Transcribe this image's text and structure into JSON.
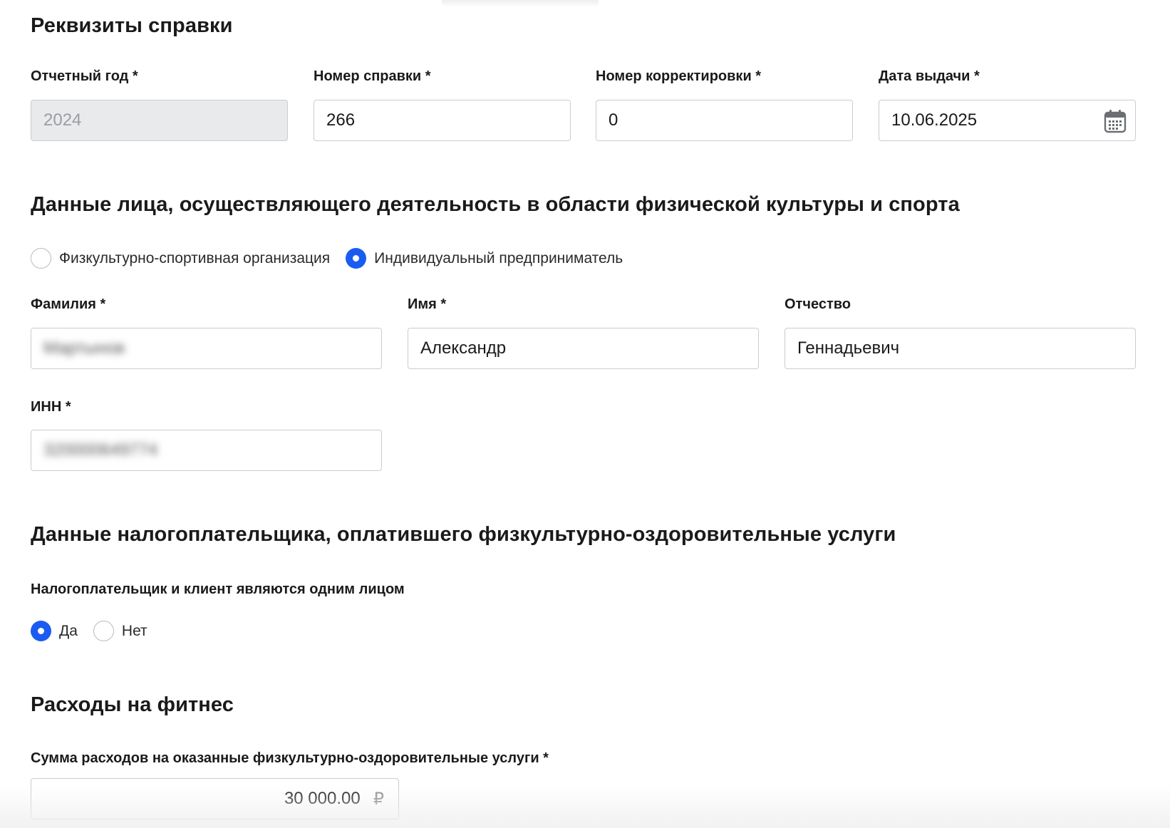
{
  "section_requisites": {
    "title": "Реквизиты справки",
    "report_year": {
      "label": "Отчетный год *",
      "value": "2024"
    },
    "cert_number": {
      "label": "Номер справки *",
      "value": "266"
    },
    "correction_number": {
      "label": "Номер корректировки *",
      "value": "0"
    },
    "issue_date": {
      "label": "Дата выдачи *",
      "value": "10.06.2025",
      "icon": "calendar-icon"
    }
  },
  "section_provider": {
    "title": "Данные лица, осуществляющего деятельность в области физической культуры и спорта",
    "type_options": [
      {
        "label": "Физкультурно-спортивная организация",
        "checked": false
      },
      {
        "label": "Индивидуальный предприниматель",
        "checked": true
      }
    ],
    "last_name": {
      "label": "Фамилия *",
      "value": "Мартынов"
    },
    "first_name": {
      "label": "Имя *",
      "value": "Александр"
    },
    "patronymic": {
      "label": "Отчество",
      "value": "Геннадьевич"
    },
    "inn": {
      "label": "ИНН *",
      "value": "320000649774"
    }
  },
  "section_taxpayer": {
    "title": "Данные налогоплательщика, оплатившего физкультурно-оздоровительные услуги",
    "same_person_label": "Налогоплательщик и клиент являются одним лицом",
    "options": [
      {
        "label": "Да",
        "checked": true
      },
      {
        "label": "Нет",
        "checked": false
      }
    ]
  },
  "section_expenses": {
    "title": "Расходы на фитнес",
    "amount_label": "Сумма расходов на оказанные физкультурно-оздоровительные услуги *",
    "amount_value": "30 000.00",
    "currency": "₽"
  },
  "colors": {
    "accent": "#1a5cf2",
    "border": "#c9ccd1",
    "disabled_bg": "#e9eaec"
  }
}
